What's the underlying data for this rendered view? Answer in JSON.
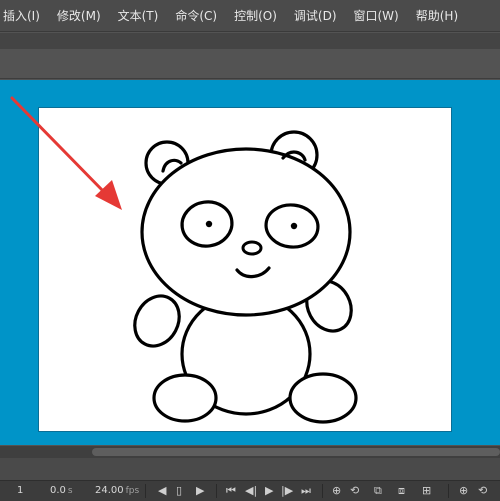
{
  "menu": {
    "items": [
      {
        "label": "插入(I)"
      },
      {
        "label": "修改(M)"
      },
      {
        "label": "文本(T)"
      },
      {
        "label": "命令(C)"
      },
      {
        "label": "控制(O)"
      },
      {
        "label": "调试(D)"
      },
      {
        "label": "窗口(W)"
      },
      {
        "label": "帮助(H)"
      }
    ]
  },
  "colors": {
    "stage_bg": "#0094c8",
    "canvas": "#ffffff",
    "annotation_arrow": "#e53935",
    "ui_dark": "#3c3c3c"
  },
  "timeline": {
    "frame": "1",
    "time_value": "0.0",
    "time_unit": "s",
    "fps_value": "24.00",
    "fps_unit": "fps",
    "icons": [
      "prev-arrow-icon",
      "mobile-icon",
      "next-arrow-icon",
      "first-frame-icon",
      "step-back-icon",
      "play-icon",
      "step-forward-icon",
      "last-frame-icon",
      "center-frame-icon",
      "loop-icon",
      "onion-skin-icon",
      "onion-skin-outline-icon",
      "edit-multiple-icon",
      "center-frame-icon",
      "loop-icon"
    ]
  }
}
